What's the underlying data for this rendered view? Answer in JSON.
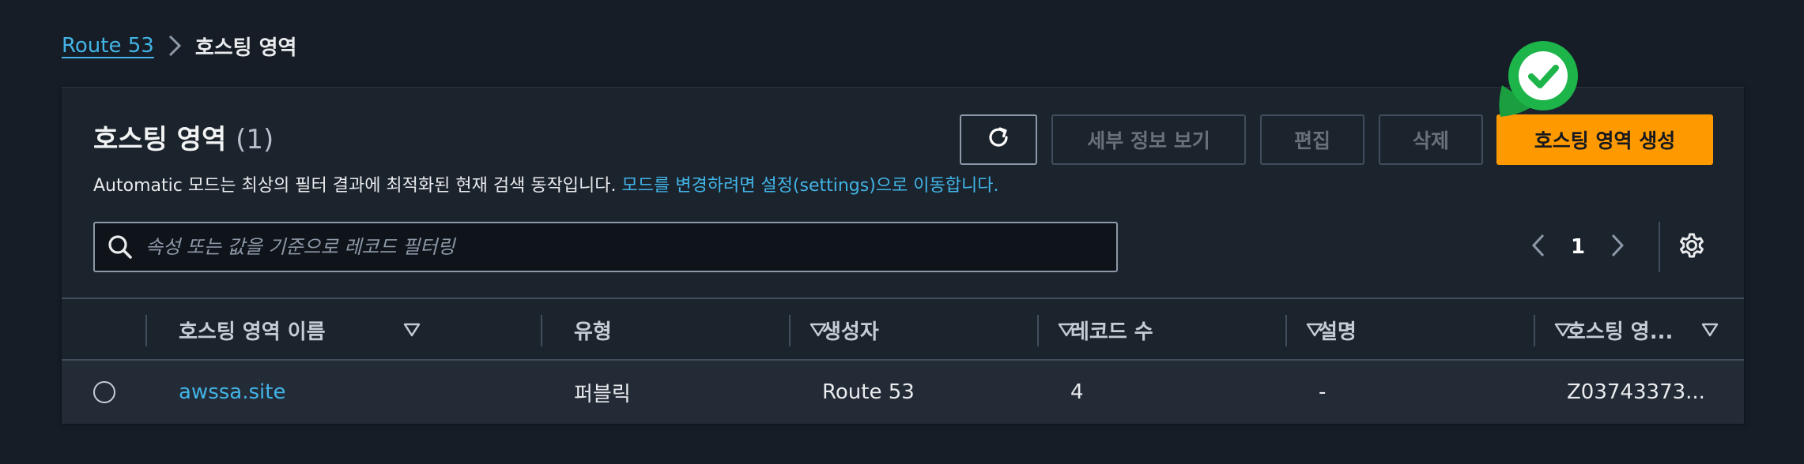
{
  "breadcrumb": {
    "root": "Route 53",
    "current": "호스팅 영역"
  },
  "panel": {
    "title": "호스팅 영역",
    "count": "(1)",
    "description": "Automatic 모드는 최상의 필터 결과에 최적화된 현재 검색 동작입니다. ",
    "description_link": "모드를 변경하려면 설정(settings)으로 이동합니다."
  },
  "actions": {
    "refresh_icon": "refresh-icon",
    "details": "세부 정보 보기",
    "edit": "편집",
    "delete": "삭제",
    "create": "호스팅 영역 생성"
  },
  "search": {
    "placeholder": "속성 또는 값을 기준으로 레코드 필터링",
    "value": ""
  },
  "pagination": {
    "current_page": "1"
  },
  "table": {
    "columns": [
      "호스팅 영역 이름",
      "유형",
      "생성자",
      "레코드 수",
      "설명",
      "호스팅 영..."
    ],
    "rows": [
      {
        "name": "awssa.site",
        "type": "퍼블릭",
        "created_by": "Route 53",
        "record_count": "4",
        "description": "-",
        "zone_id": "Z03743373..."
      }
    ]
  },
  "colors": {
    "background": "#161d26",
    "panel": "#1b232d",
    "accent_link": "#42b4e6",
    "primary_button": "#ff9900",
    "check_badge": "#1db54a"
  }
}
